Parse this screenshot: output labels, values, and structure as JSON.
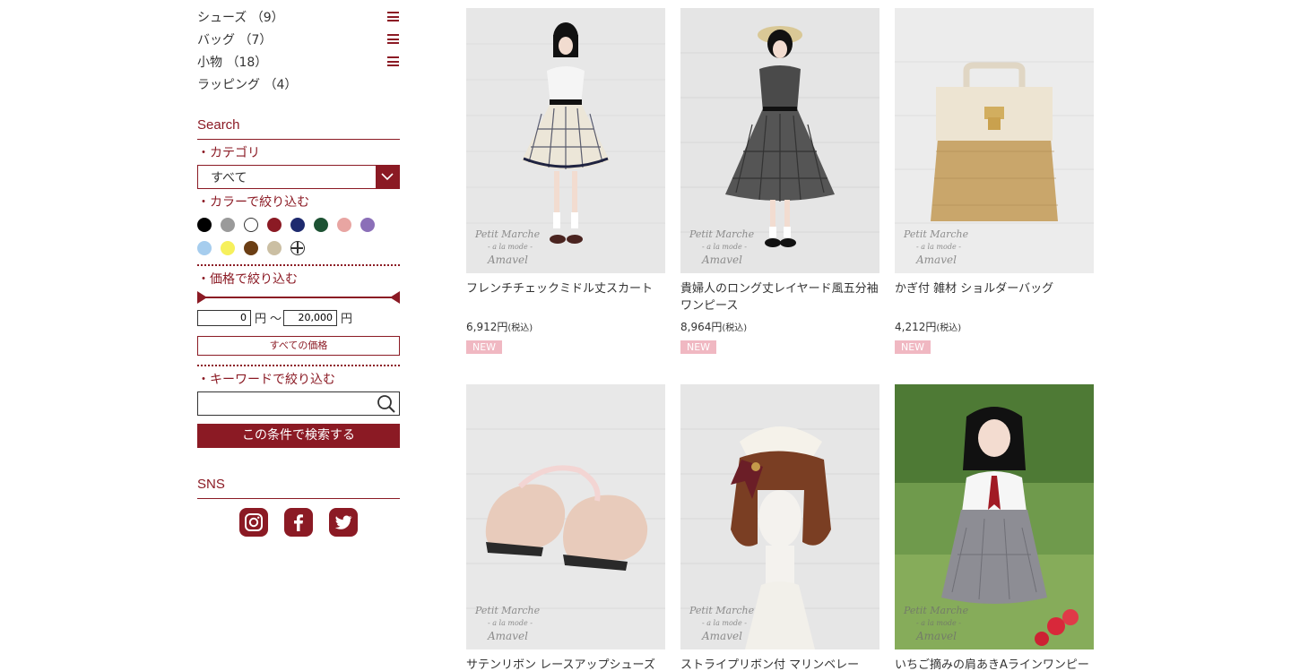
{
  "sidebar": {
    "categories": [
      {
        "label": "シューズ （9）"
      },
      {
        "label": "バッグ （7）"
      },
      {
        "label": "小物 （18）"
      },
      {
        "label": "ラッピング （4）"
      }
    ],
    "search_title": "Search",
    "category_label": "・カテゴリ",
    "category_value": "すべて",
    "color_label": "・カラーで絞り込む",
    "colors": [
      "#000000",
      "#9a9a9a",
      "#ffffff",
      "#8b1a24",
      "#1e2a6e",
      "#1d5233",
      "#e8a5a2",
      "#8b6fb8",
      "#a6cdee",
      "#f6f05c",
      "#6b3e14",
      "#cbbfa3",
      "multi"
    ],
    "price_label": "・価格で絞り込む",
    "price_min": "0",
    "price_max": "20,000",
    "yen": "円",
    "tilde": "〜",
    "all_price": "すべての価格",
    "keyword_label": "・キーワードで絞り込む",
    "search_button": "この条件で検索する",
    "sns_title": "SNS",
    "sns": [
      "instagram-icon",
      "facebook-icon",
      "twitter-icon"
    ]
  },
  "watermark": {
    "line1": "Petit Marche",
    "line2": "- a la mode -",
    "line3": "Amavel"
  },
  "products": [
    {
      "name": "フレンチチェックミドル丈スカート",
      "price": "6,912円",
      "tax": "(税込)",
      "badge": "NEW"
    },
    {
      "name": "貴婦人のロング丈レイヤード風五分袖ワンピース",
      "price": "8,964円",
      "tax": "(税込)",
      "badge": "NEW"
    },
    {
      "name": "かぎ付 雑材 ショルダーバッグ",
      "price": "4,212円",
      "tax": "(税込)",
      "badge": "NEW"
    },
    {
      "name": "サテンリボン レースアップシューズ"
    },
    {
      "name": "ストライプリボン付 マリンベレー"
    },
    {
      "name": "いちご摘みの肩あきAラインワンピー"
    }
  ]
}
